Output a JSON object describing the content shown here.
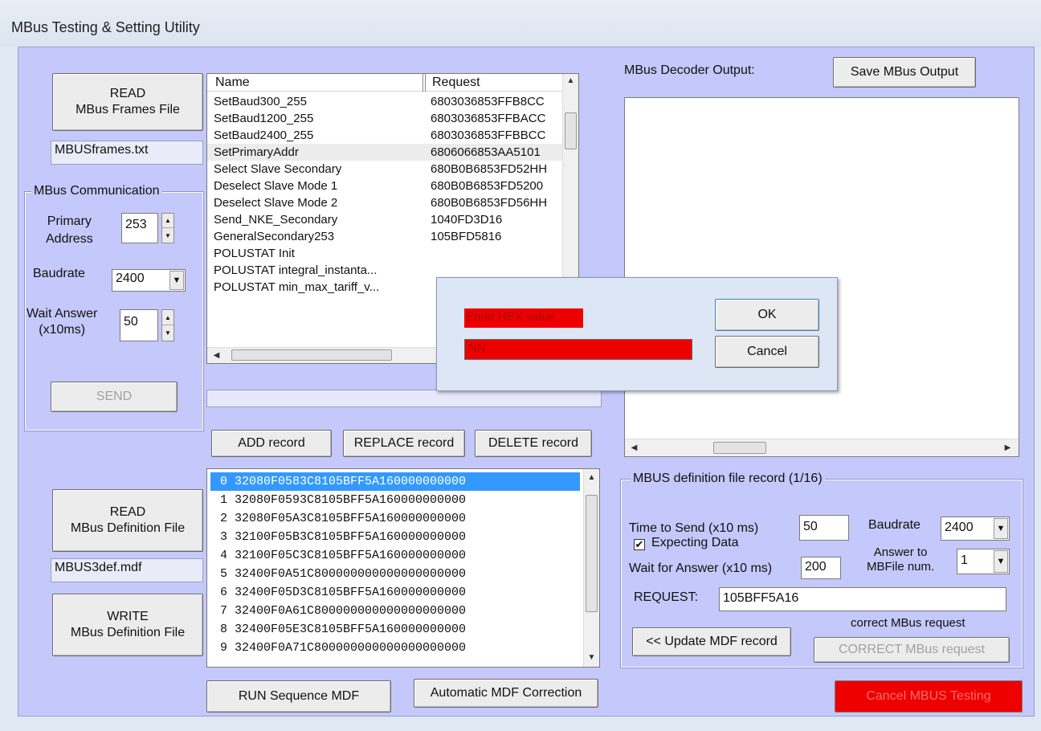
{
  "window": {
    "title": "MBus Testing & Setting Utility"
  },
  "frames_panel": {
    "read_button": "READ\nMBus Frames File",
    "file_name": "MBUSframes.txt",
    "columns": [
      "Name",
      "Request"
    ],
    "rows": [
      [
        "SetBaud300_255",
        "6803036853FFB8CC"
      ],
      [
        "SetBaud1200_255",
        "6803036853FFBACC"
      ],
      [
        "SetBaud2400_255",
        "6803036853FFBBCC"
      ],
      [
        "SetPrimaryAddr",
        "6806066853AA5101"
      ],
      [
        "Select Slave Secondary",
        "680B0B6853FD52HH"
      ],
      [
        "Deselect Slave Mode 1",
        "680B0B6853FD5200"
      ],
      [
        "Deselect Slave Mode 2",
        "680B0B6853FD56HH"
      ],
      [
        "Send_NKE_Secondary",
        "1040FD3D16"
      ],
      [
        "GeneralSecondary253",
        "105BFD5816"
      ],
      [
        "POLUSTAT Init",
        ""
      ],
      [
        "POLUSTAT integral_instanta...",
        ""
      ],
      [
        "POLUSTAT min_max_tariff_v...",
        ""
      ]
    ]
  },
  "communication": {
    "legend": "MBus Communication",
    "primary_address_label": "Primary\nAddress",
    "primary_address_value": "253",
    "baudrate_label": "Baudrate",
    "baudrate_value": "2400",
    "wait_answer_label": "Wait Answer\n(x10ms)",
    "wait_answer_value": "50",
    "send_button": "SEND"
  },
  "record_buttons": {
    "add": "ADD record",
    "replace": "REPLACE record",
    "delete": "DELETE record"
  },
  "mdf_panel": {
    "read_button": "READ\nMBus Definition File",
    "file_name": "MBUS3def.mdf",
    "write_button": "WRITE\nMBus Definition File",
    "rows": [
      "0 32080F0583C8105BFF5A160000000000",
      "1 32080F0593C8105BFF5A160000000000",
      "2 32080F05A3C8105BFF5A160000000000",
      "3 32100F05B3C8105BFF5A160000000000",
      "4 32100F05C3C8105BFF5A160000000000",
      "5 32400F0A51C800000000000000000000",
      "6 32400F05D3C8105BFF5A160000000000",
      "7 32400F0A61C800000000000000000000",
      "8 32400F05E3C8105BFF5A160000000000",
      "9 32400F0A71C800000000000000000000"
    ],
    "run_button": "RUN Sequence MDF",
    "auto_correct_button": "Automatic MDF Correction"
  },
  "decoder": {
    "label": "MBus Decoder Output:",
    "save_button": "Save MBus Output"
  },
  "definition_record": {
    "legend": "MBUS definition file record (1/16)",
    "time_to_send_label": "Time to Send (x10 ms)",
    "time_to_send_value": "50",
    "baudrate_label": "Baudrate",
    "baudrate_value": "2400",
    "expecting_data_label": "Expecting Data",
    "wait_for_answer_label": "Wait for Answer (x10 ms)",
    "wait_for_answer_value": "200",
    "answer_to_label": "Answer to\nMBFile num.",
    "answer_to_value": "1",
    "request_label": "REQUEST:",
    "request_value": "105BFF5A16",
    "correct_hint": "correct MBus request",
    "update_button": "<< Update MDF record",
    "correct_button": "CORRECT MBus request"
  },
  "cancel_button": "Cancel MBUS Testing",
  "dialog": {
    "prompt": "Enter HEX value",
    "value": "NN",
    "ok": "OK",
    "cancel": "Cancel"
  },
  "colors": {
    "client_bg": "#c5c8fa",
    "alert_red": "#ee0000",
    "selection": "#3399ff"
  }
}
